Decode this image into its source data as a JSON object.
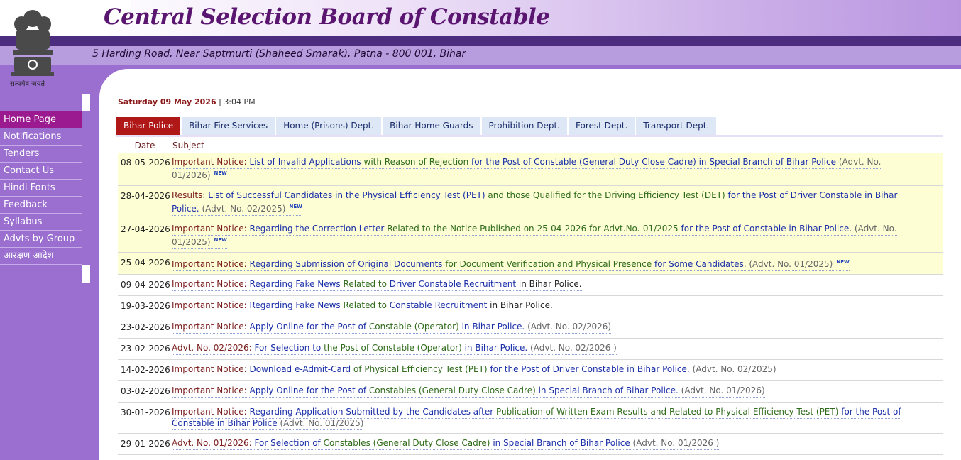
{
  "header": {
    "title": "Central Selection Board of Constable",
    "address": "5 Harding Road, Near Saptmurti (Shaheed Smarak), Patna - 800 001, Bihar",
    "emblem_caption": "सत्यमेव जयते"
  },
  "sidebar": {
    "items": [
      {
        "label": "Home Page"
      },
      {
        "label": "Notifications"
      },
      {
        "label": "Tenders"
      },
      {
        "label": "Contact Us"
      },
      {
        "label": "Hindi Fonts"
      },
      {
        "label": "Feedback"
      },
      {
        "label": "Syllabus"
      },
      {
        "label": "Advts by Group"
      },
      {
        "label": "आरक्षण आदेश"
      }
    ]
  },
  "date": {
    "day": "Saturday 09 May 2026",
    "sep": " | ",
    "time": "3:04 PM"
  },
  "tabs": [
    {
      "label": "Bihar Police"
    },
    {
      "label": "Bihar Fire Services"
    },
    {
      "label": "Home (Prisons) Dept."
    },
    {
      "label": "Bihar Home Guards"
    },
    {
      "label": "Prohibition Dept."
    },
    {
      "label": "Forest Dept."
    },
    {
      "label": "Transport Dept."
    }
  ],
  "table": {
    "headers": {
      "date": "Date",
      "subject": "Subject"
    },
    "new_badge": "NEW",
    "rows": [
      {
        "date": "08-05-2026",
        "prefix": "Important Notice:",
        "p1": "List of Invalid Applications",
        "p2": "with Reason of Rejection",
        "p3": "for the Post of Constable (General Duty Close Cadre) in Special Branch of Bihar Police",
        "advt": "(Advt. No. 01/2026)"
      },
      {
        "date": "28-04-2026",
        "prefix": "Results:",
        "p1": "List of Successful Candidates in the Physical Efficiency Test (PET)",
        "p2": "and those Qualified for the Driving Efficiency Test (DET)",
        "p3": "for the Post of Driver Constable in Bihar Police.",
        "advt": "(Advt. No. 02/2025)"
      },
      {
        "date": "27-04-2026",
        "prefix": "Important Notice:",
        "p1": "Regarding the Correction Letter",
        "p2": "Related to the Notice Published on 25-04-2026 for Advt.No.-01/2025",
        "p3": "for the Post of Constable in Bihar Police.",
        "advt": "(Advt. No. 01/2025)"
      },
      {
        "date": "25-04-2026",
        "prefix": "Important Notice:",
        "p1": "Regarding Submission of Original Documents",
        "p2": "for Document Verification and Physical Presence",
        "p3": "for Some Candidates.",
        "advt": "(Advt. No. 01/2025)"
      },
      {
        "date": "09-04-2026",
        "prefix": "Important Notice:",
        "p1": "Regarding Fake News",
        "p2": "Related to",
        "p3": "Driver Constable Recruitment",
        "p4": "in Bihar Police."
      },
      {
        "date": "19-03-2026",
        "prefix": "Important Notice:",
        "p1": "Regarding Fake News",
        "p2": "Related to",
        "p3": "Constable Recruitment",
        "p4": "in Bihar Police."
      },
      {
        "date": "23-02-2026",
        "prefix": "Important Notice:",
        "p1": "Apply Online for the Post of",
        "p2": "Constable",
        "p3": "(Operator)",
        "p4": "in Bihar Police.",
        "advt": "(Advt. No. 02/2026)"
      },
      {
        "date": "23-02-2026",
        "prefix": "Advt. No. 02/2026:",
        "p1": "For Selection to",
        "p2": "the Post of Constable (Operator)",
        "p3": "in Bihar Police.",
        "advt": "(Advt. No. 02/2026 )"
      },
      {
        "date": "14-02-2026",
        "prefix": "Important Notice:",
        "p1": "Download e-Admit-Card",
        "p2": "of Physical Efficiency Test (PET)",
        "p3": "for the Post of Driver Constable in Bihar Police.",
        "advt": "(Advt. No. 02/2025)"
      },
      {
        "date": "03-02-2026",
        "prefix": "Important Notice:",
        "p1": "Apply Online for the Post of",
        "p2": "Constables (General Duty Close Cadre)",
        "p3": "in Special Branch of Bihar Police.",
        "advt": "(Advt. No. 01/2026)"
      },
      {
        "date": "30-01-2026",
        "prefix": "Important Notice:",
        "p1": "Regarding Application Submitted by the Candidates after",
        "p2": "Publication of Written Exam Results and Related to Physical Efficiency Test (PET)",
        "p3": "for the Post of Constable in Bihar Police",
        "advt": "(Advt. No. 01/2025)"
      },
      {
        "date": "29-01-2026",
        "prefix": "Advt. No. 01/2026:",
        "p1": "For Selection of",
        "p2": "Constables (General Duty Close Cadre)",
        "p3": "in Special Branch of Bihar Police",
        "advt": "(Advt. No. 01/2026 )"
      }
    ]
  },
  "colors": {
    "accent": "#9b1a90",
    "tab_active": "#b01818",
    "sidebar_bg": "#9a6fcf",
    "highlight_row": "#fefed5"
  }
}
